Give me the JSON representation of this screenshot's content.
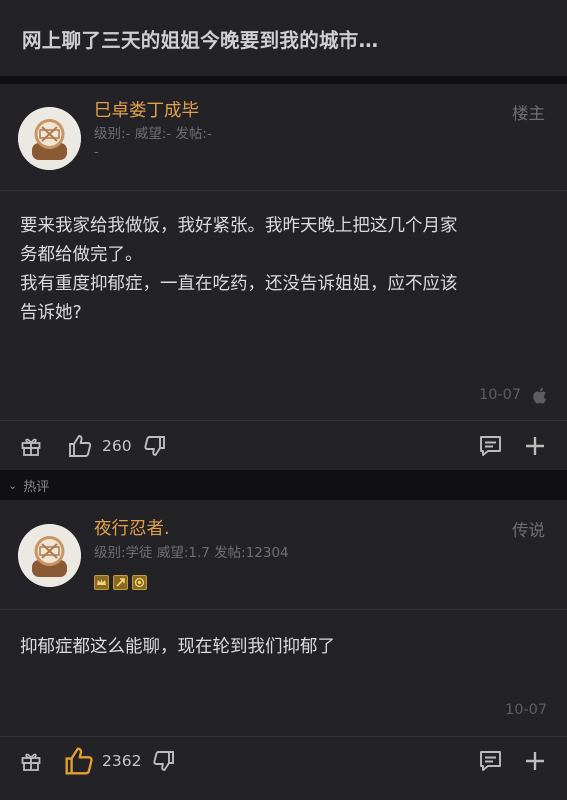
{
  "thread": {
    "title": "网上聊了三天的姐姐今晚要到我的城市…"
  },
  "post1": {
    "username": "巳卓娄丁成毕",
    "meta_line1": "级别:- 威望:- 发帖:-",
    "meta_line2": "-",
    "role": "楼主",
    "content_line1": "要来我家给我做饭，我好紧张。我昨天晚上把这几个月家",
    "content_line2": "务都给做完了。",
    "content_line3": "我有重度抑郁症，一直在吃药，还没告诉姐姐，应不应该",
    "content_line4": "告诉她?",
    "date": "10-07",
    "like_count": "260",
    "icons": [
      "gift-icon",
      "thumbs-up-icon",
      "thumbs-down-icon",
      "comment-icon",
      "plus-icon",
      "apple-icon"
    ]
  },
  "hot_section": {
    "label": "热评"
  },
  "post2": {
    "username": "夜行忍者.",
    "meta_line1": "级别:学徒 威望:1.7 发帖:12304",
    "role": "传说",
    "content_line1": "抑郁症都这么能聊，现在轮到我们抑郁了",
    "date": "10-07",
    "like_count": "2362",
    "badges": [
      "badge-crown-icon",
      "badge-arrow-icon",
      "badge-target-icon"
    ],
    "icons": [
      "gift-icon",
      "thumbs-up-icon",
      "thumbs-down-icon",
      "comment-icon",
      "plus-icon"
    ]
  },
  "colors": {
    "background": "#0f0f10",
    "card": "#222227",
    "username": "#e2a04a",
    "liked": "#e6a030",
    "muted": "#6e6e74",
    "text": "#dcdcdc"
  }
}
